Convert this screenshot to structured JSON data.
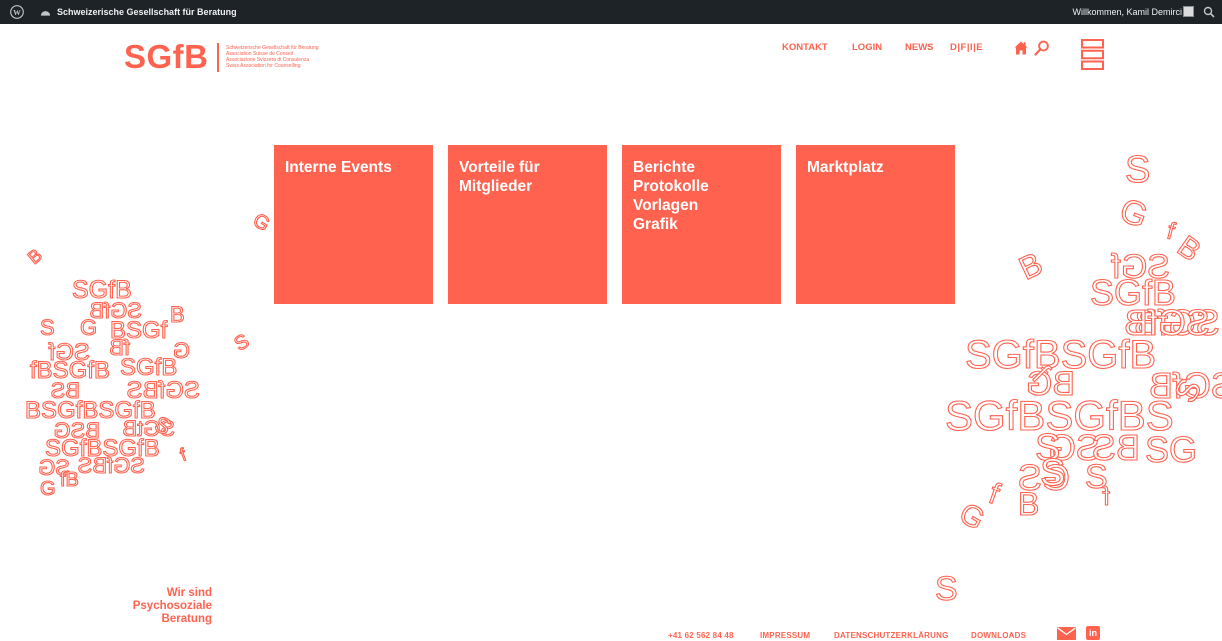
{
  "admin_bar": {
    "site_name": "Schweizerische Gesellschaft für Beratung",
    "welcome": "Willkommen, Kamil Demirci"
  },
  "header": {
    "logo": "SGfB",
    "logo_sub": [
      "Schweizerische Gesellschaft für Beratung",
      "Association Suisse de Conseil",
      "Associazione Svizzera di Consulenza",
      "Swiss Association for Counselling"
    ],
    "nav": {
      "kontakt": "KONTAKT",
      "login": "LOGIN",
      "news": "NEWS",
      "languages": "D|F|I|E"
    }
  },
  "tiles": [
    {
      "lines": [
        "Interne Events"
      ]
    },
    {
      "lines": [
        "Vorteile für",
        "Mitglieder"
      ]
    },
    {
      "lines": [
        "Berichte",
        "Protokolle",
        "Vorlagen",
        "Grafik"
      ]
    },
    {
      "lines": [
        "Marktplatz"
      ]
    }
  ],
  "tagline": [
    "Wir sind",
    "Psychosoziale",
    "Beratung"
  ],
  "footer": {
    "phone": "+41 62 562 84 48",
    "impressum": "IMPRESSUM",
    "datenschutz": "DATENSCHUTZERKLÄRUNG",
    "downloads": "DOWNLOADS",
    "linkedin": "in"
  },
  "colors": {
    "brand": "#ff6350",
    "admin_bar": "#1d2327"
  },
  "icons": [
    "wordpress-icon",
    "site-icon",
    "search-icon",
    "home-icon",
    "menu-icon",
    "mail-icon",
    "linkedin-icon"
  ]
}
